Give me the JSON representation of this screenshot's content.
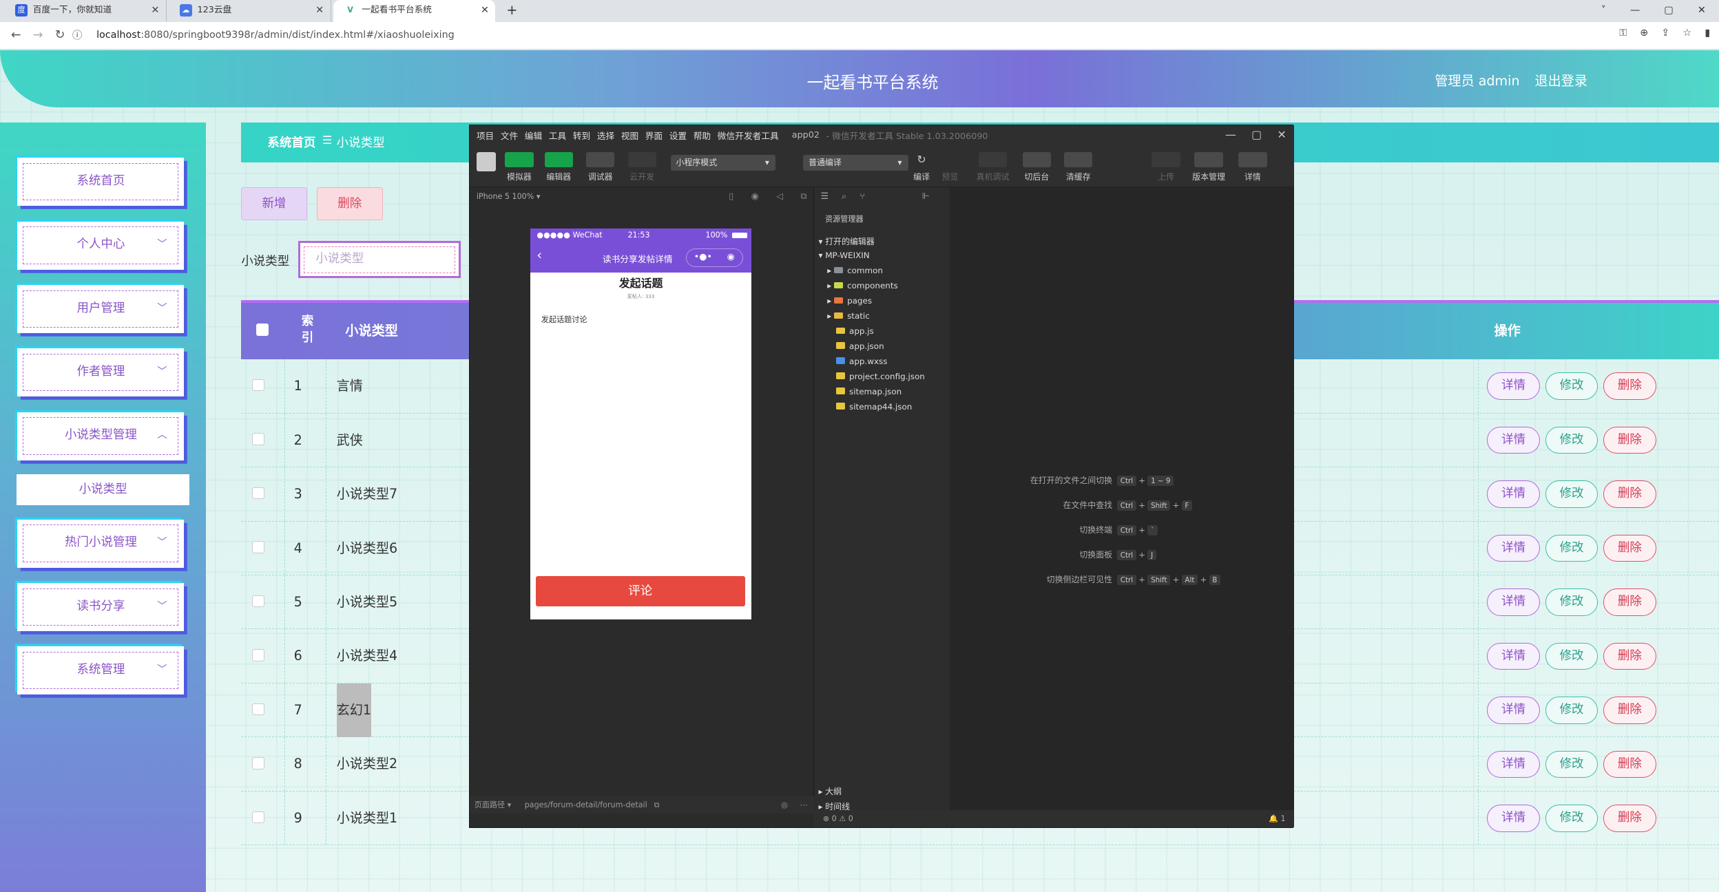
{
  "browser": {
    "tabs": [
      {
        "title": "百度一下，你就知道",
        "icon": "baidu-icon"
      },
      {
        "title": "123云盘",
        "icon": "cloud-icon"
      },
      {
        "title": "一起看书平台系统",
        "icon": "vue-icon"
      }
    ],
    "new_tab": "+",
    "url_host": "localhost",
    "url_rest": ":8080/springboot9398r/admin/dist/index.html#/xiaoshuoleixing",
    "window_controls": [
      "˅",
      "—",
      "▢",
      "✕"
    ]
  },
  "header": {
    "title": "一起看书平台系统",
    "user": "管理员 admin",
    "logout": "退出登录"
  },
  "sidebar": {
    "items": [
      {
        "label": "系统首页",
        "chev": ""
      },
      {
        "label": "个人中心",
        "chev": "﹀"
      },
      {
        "label": "用户管理",
        "chev": "﹀"
      },
      {
        "label": "作者管理",
        "chev": "﹀"
      },
      {
        "label": "小说类型管理",
        "chev": "︿"
      },
      {
        "label": "小说类型",
        "chev": ""
      },
      {
        "label": "热门小说管理",
        "chev": "﹀"
      },
      {
        "label": "读书分享",
        "chev": "﹀"
      },
      {
        "label": "系统管理",
        "chev": "﹀"
      }
    ]
  },
  "breadcrumb": {
    "home": "系统首页",
    "sep": "☰",
    "current": "小说类型"
  },
  "actions": {
    "add": "新增",
    "delete": "删除"
  },
  "search": {
    "label": "小说类型",
    "placeholder": "小说类型"
  },
  "table": {
    "headers": {
      "index": "索引",
      "type": "小说类型",
      "ops": "操作"
    },
    "ops": {
      "detail": "详情",
      "edit": "修改",
      "delete": "删除"
    },
    "rows": [
      {
        "idx": "1",
        "name": "言情"
      },
      {
        "idx": "2",
        "name": "武侠"
      },
      {
        "idx": "3",
        "name": "小说类型7"
      },
      {
        "idx": "4",
        "name": "小说类型6"
      },
      {
        "idx": "5",
        "name": "小说类型5"
      },
      {
        "idx": "6",
        "name": "小说类型4"
      },
      {
        "idx": "7",
        "name": "玄幻1"
      },
      {
        "idx": "8",
        "name": "小说类型2"
      },
      {
        "idx": "9",
        "name": "小说类型1"
      }
    ]
  },
  "ide": {
    "menu": [
      "项目",
      "文件",
      "编辑",
      "工具",
      "转到",
      "选择",
      "视图",
      "界面",
      "设置",
      "帮助",
      "微信开发者工具"
    ],
    "title": "app02",
    "title_suffix": "- 微信开发者工具 Stable 1.03.2006090",
    "window_controls": [
      "—",
      "▢",
      "✕"
    ],
    "toolbar": {
      "simulator": "模拟器",
      "editor": "编辑器",
      "debugger": "调试器",
      "cloud": "云开发",
      "mode": "小程序模式",
      "compile_mode": "普通编译",
      "compile": "编译",
      "preview": "预览",
      "remote_debug": "真机调试",
      "backstage": "切后台",
      "clear_cache": "清缓存",
      "upload": "上传",
      "version": "版本管理",
      "details": "详情"
    },
    "sim": {
      "device": "iPhone 5 100% ▾",
      "path_label": "页面路径 ▾",
      "path": "pages/forum-detail/forum-detail"
    },
    "phone": {
      "carrier": "●●●●● WeChat",
      "time": "21:53",
      "battery": "100%",
      "nav_title": "读书分享发帖详情",
      "heading": "发起话题",
      "sub": "发帖人: 333",
      "body": "发起话题讨论",
      "button": "评论"
    },
    "explorer": {
      "header": "资源管理器",
      "open_editors": "打开的编辑器",
      "project": "MP-WEIXIN",
      "items": [
        {
          "name": "common",
          "kind": "folder",
          "color": "#8a8f98"
        },
        {
          "name": "components",
          "kind": "folder",
          "color": "#c8d84a"
        },
        {
          "name": "pages",
          "kind": "folder",
          "color": "#e8763d"
        },
        {
          "name": "static",
          "kind": "folder",
          "color": "#e8b93d"
        },
        {
          "name": "app.js",
          "kind": "file",
          "color": "#e8c53d"
        },
        {
          "name": "app.json",
          "kind": "file",
          "color": "#e8c53d"
        },
        {
          "name": "app.wxss",
          "kind": "file",
          "color": "#4a8fe8"
        },
        {
          "name": "project.config.json",
          "kind": "file",
          "color": "#e8c53d"
        },
        {
          "name": "sitemap.json",
          "kind": "file",
          "color": "#e8c53d"
        },
        {
          "name": "sitemap44.json",
          "kind": "file",
          "color": "#e8c53d"
        }
      ],
      "outline": "大纲",
      "timeline": "时间线"
    },
    "shortcuts": [
      {
        "label": "在打开的文件之间切换",
        "keys": [
          "Ctrl",
          "1 ~ 9"
        ]
      },
      {
        "label": "在文件中查找",
        "keys": [
          "Ctrl",
          "Shift",
          "F"
        ]
      },
      {
        "label": "切换终端",
        "keys": [
          "Ctrl",
          "`"
        ]
      },
      {
        "label": "切换面板",
        "keys": [
          "Ctrl",
          "J"
        ]
      },
      {
        "label": "切换侧边栏可见性",
        "keys": [
          "Ctrl",
          "Shift",
          "Alt",
          "B"
        ]
      }
    ],
    "status": {
      "problems": "⊗ 0 ⚠ 0",
      "notify": "🔔 1"
    }
  }
}
